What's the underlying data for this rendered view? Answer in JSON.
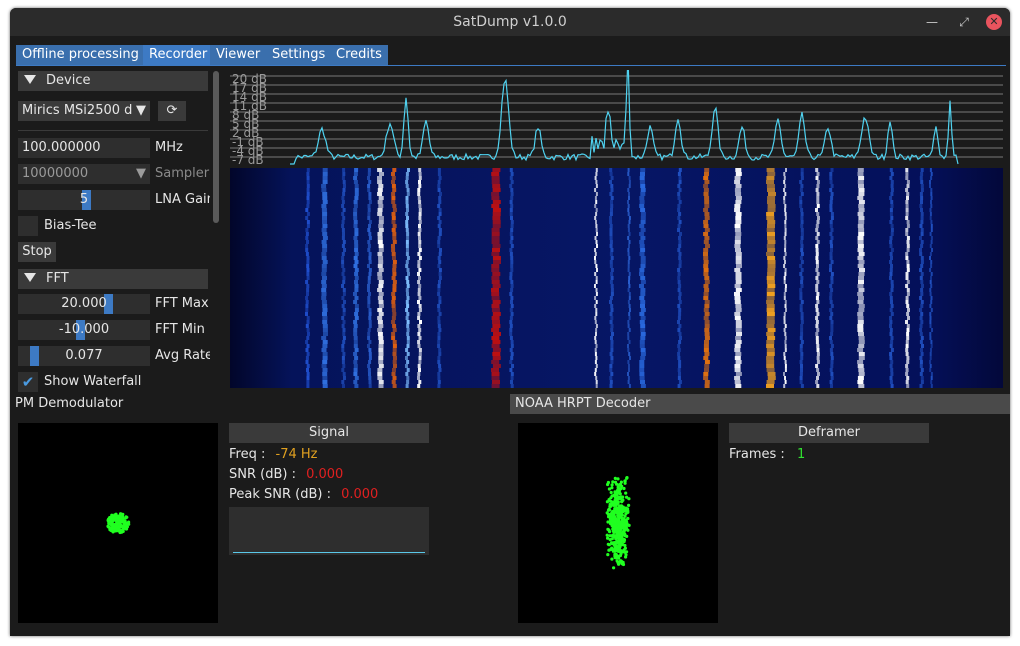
{
  "window": {
    "title": "SatDump v1.0.0"
  },
  "tabs": [
    "Offline processing",
    "Recorder",
    "Viewer",
    "Settings",
    "Credits"
  ],
  "active_tab": 1,
  "device": {
    "section_label": "Device",
    "selected_device": "Mirics MSi2500 d",
    "frequency_value": "100.000000",
    "frequency_unit": "MHz",
    "samplerate_value": "10000000",
    "samplerate_label": "Samplerate",
    "lna_gain_value": "5",
    "lna_gain_label": "LNA Gain",
    "bias_tee_label": "Bias-Tee",
    "stop_label": "Stop"
  },
  "fft": {
    "section_label": "FFT",
    "fft_max_value": "20.000",
    "fft_max_label": "FFT Max",
    "fft_min_value": "-10.000",
    "fft_min_label": "FFT Min",
    "avg_rate_value": "0.077",
    "avg_rate_label": "Avg Rate",
    "show_waterfall_label": "Show Waterfall"
  },
  "spectrum": {
    "db_labels": [
      "20 dB",
      "17 dB",
      "14 dB",
      "11 dB",
      "8 dB",
      "5 dB",
      "2 dB",
      "-1 dB",
      "-4 dB",
      "-7 dB"
    ],
    "colors": {
      "spectrum_line": "#4fd2f0",
      "grid": "#9a9a9a"
    }
  },
  "pm_demod": {
    "title": "PM Demodulator",
    "signal_header": "Signal",
    "freq_label": "Freq :",
    "freq_value": "-74 Hz",
    "snr_label": "SNR (dB) :",
    "snr_value": "0.000",
    "peak_snr_label": "Peak SNR (dB) :",
    "peak_snr_value": "0.000"
  },
  "hrpt": {
    "title": "NOAA HRPT Decoder",
    "deframer_header": "Deframer",
    "frames_label": "Frames :",
    "frames_value": "1"
  }
}
